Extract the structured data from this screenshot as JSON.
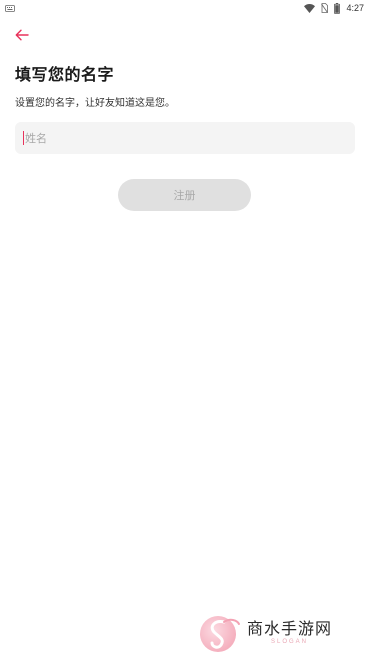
{
  "status_bar": {
    "time": "4:27",
    "icons": [
      "keyboard-icon",
      "wifi-icon",
      "no-sim-icon",
      "battery-icon"
    ]
  },
  "header": {
    "back_icon": "arrow-left-icon"
  },
  "page": {
    "title": "填写您的名字",
    "subtitle": "设置您的名字，让好友知道这是您。"
  },
  "form": {
    "name_value": "",
    "name_placeholder": "姓名",
    "register_label": "注册"
  },
  "watermark": {
    "text": "商水手游网",
    "slogan": "SLOGAN"
  },
  "colors": {
    "accent": "#e8325b",
    "input_bg": "#f4f4f4",
    "button_disabled_bg": "#e0e0e0",
    "button_disabled_text": "#a9a9a9"
  }
}
